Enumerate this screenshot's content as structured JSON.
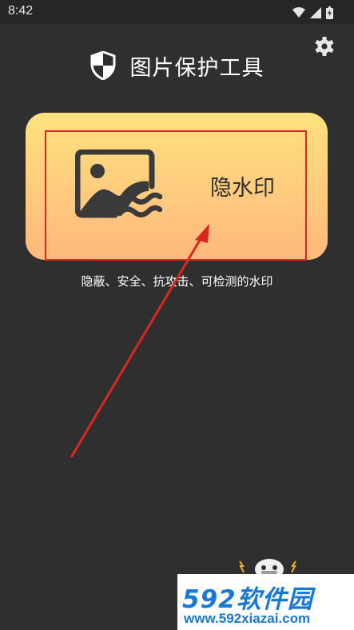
{
  "status_bar": {
    "time": "8:42",
    "icons": [
      "wifi-icon",
      "cellular-signal-icon",
      "battery-icon"
    ]
  },
  "header": {
    "title": "图片保护工具",
    "logo_icon": "shield-icon",
    "settings_icon": "gear-icon"
  },
  "main": {
    "feature_card": {
      "label": "隐水印",
      "icon": "image-with-waves-icon",
      "gradient": [
        "#ffe27e",
        "#ffb87d"
      ]
    },
    "description": "隐蔽、安全、抗攻击、可检测的水印"
  },
  "annotation": {
    "color": "#d8281f",
    "shapes": [
      "highlight-box",
      "pointer-arrow"
    ]
  },
  "watermark": {
    "brand": "592软件园",
    "url": "www.592xiazai.com",
    "color": "#1778d8"
  },
  "colors": {
    "background": "#2f2f2f",
    "status_bar": "#262626"
  }
}
